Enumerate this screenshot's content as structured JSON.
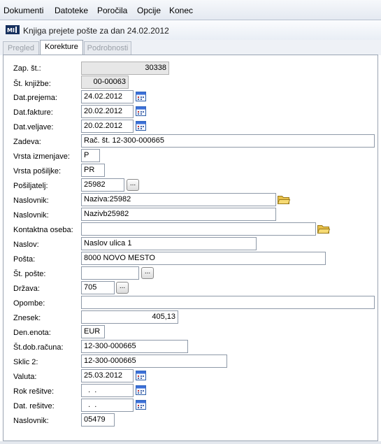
{
  "menu": [
    "Dokumenti",
    "Datoteke",
    "Poročila",
    "Opcije",
    "Konec"
  ],
  "window": {
    "title": "Knjiga prejete pošte za dan 24.02.2012"
  },
  "tabs": [
    "Pregled",
    "Korekture",
    "Podrobnosti"
  ],
  "active_tab": "Korekture",
  "form": {
    "zap_st": {
      "label": "Zap. št.:",
      "value": "30338"
    },
    "st_knjizbe": {
      "label": "Št. knjižbe:",
      "value": "00-00063"
    },
    "dat_prejema": {
      "label": "Dat.prejema:",
      "value": "24.02.2012"
    },
    "dat_fakture": {
      "label": "Dat.fakture:",
      "value": "20.02.2012"
    },
    "dat_veljave": {
      "label": "Dat.veljave:",
      "value": "20.02.2012"
    },
    "zadeva": {
      "label": "Zadeva:",
      "value": "Rač. št. 12-300-000665"
    },
    "vrsta_izmenjave": {
      "label": "Vrsta izmenjave:",
      "value": "P"
    },
    "vrsta_posiljke": {
      "label": "Vrsta pošiljke:",
      "value": "PR"
    },
    "posiljatelj": {
      "label": "Pošiljatelj:",
      "value": "25982"
    },
    "naslovnik1": {
      "label": "Naslovnik:",
      "value": "Naziva:25982"
    },
    "naslovnik2": {
      "label": "Naslovnik:",
      "value": "Nazivb25982"
    },
    "kontaktna_oseba": {
      "label": "Kontaktna oseba:",
      "value": ""
    },
    "naslov": {
      "label": "Naslov:",
      "value": "Naslov ulica 1"
    },
    "posta": {
      "label": "Pošta:",
      "value": "8000 NOVO MESTO"
    },
    "st_poste": {
      "label": "Št. pošte:",
      "value": ""
    },
    "drzava": {
      "label": "Država:",
      "value": "705"
    },
    "opombe": {
      "label": "Opombe:",
      "value": ""
    },
    "znesek": {
      "label": "Znesek:",
      "value": "405,13"
    },
    "den_enota": {
      "label": "Den.enota:",
      "value": "EUR"
    },
    "st_dob_racuna": {
      "label": "Št.dob.računa:",
      "value": "12-300-000665"
    },
    "sklic2": {
      "label": "Sklic 2:",
      "value": "12-300-000665"
    },
    "valuta": {
      "label": "Valuta:",
      "value": "25.03.2012"
    },
    "rok_resitve": {
      "label": "Rok rešitve:",
      "value": "  .  ."
    },
    "dat_resitve": {
      "label": "Dat. rešitve:",
      "value": "  .  ."
    },
    "naslovnik3": {
      "label": "Naslovnik:",
      "value": "05479"
    }
  },
  "buttons": {
    "ellipsis": "..."
  }
}
